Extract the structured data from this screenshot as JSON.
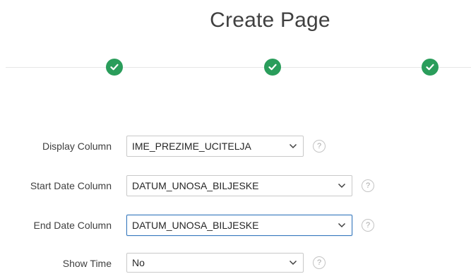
{
  "page": {
    "title": "Create Page"
  },
  "wizard": {
    "steps": [
      {
        "status": "complete",
        "icon": "check-icon"
      },
      {
        "status": "complete",
        "icon": "check-icon"
      },
      {
        "status": "complete",
        "icon": "check-icon"
      }
    ],
    "accent_color": "#2a9d5b"
  },
  "form": {
    "display_column": {
      "label": "Display Column",
      "value": "IME_PREZIME_UCITELJA",
      "help": "?"
    },
    "start_date_column": {
      "label": "Start Date Column",
      "value": "DATUM_UNOSA_BILJESKE",
      "help": "?"
    },
    "end_date_column": {
      "label": "End Date Column",
      "value": "DATUM_UNOSA_BILJESKE",
      "help": "?"
    },
    "show_time": {
      "label": "Show Time",
      "value": "No",
      "help": "?"
    }
  },
  "colors": {
    "focus_border": "#3a7bbf",
    "field_border": "#c9c9c9"
  }
}
